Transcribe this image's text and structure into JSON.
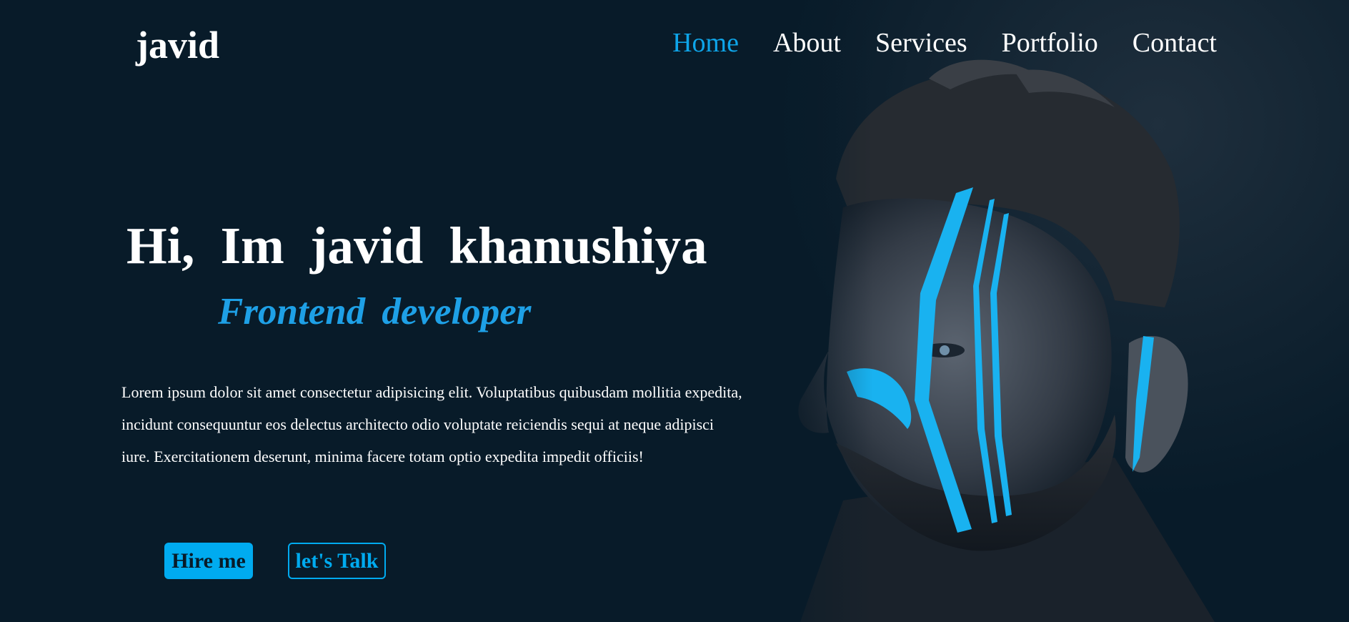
{
  "header": {
    "logo": "javid",
    "nav": [
      {
        "label": "Home",
        "active": true
      },
      {
        "label": "About",
        "active": false
      },
      {
        "label": "Services",
        "active": false
      },
      {
        "label": "Portfolio",
        "active": false
      },
      {
        "label": "Contact",
        "active": false
      }
    ]
  },
  "hero": {
    "title": "Hi, Im javid khanushiya",
    "subtitle": "Frontend developer",
    "intro": "Lorem ipsum dolor sit amet consectetur adipisicing elit. Voluptatibus quibusdam mollitia expedita, incidunt consequuntur eos delectus architecto odio voluptate reiciendis sequi at neque adipisci iure. Exercitationem deserunt, minima facere totam optio expedita impedit officiis!",
    "hire_label": "Hire me",
    "talk_label": "let's Talk"
  },
  "colors": {
    "background": "#081b29",
    "accent": "#00abf0",
    "text": "#ffffff"
  },
  "icons": {
    "portrait": "man-with-blue-face-paint-photo"
  }
}
